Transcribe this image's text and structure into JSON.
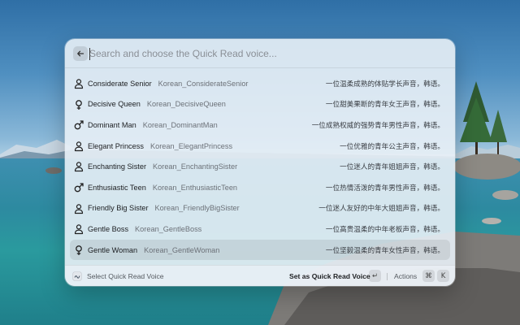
{
  "search": {
    "placeholder": "Search and choose the Quick Read voice..."
  },
  "voices": [
    {
      "title": "Considerate Senior",
      "id": "Korean_ConsiderateSenior",
      "desc": "一位温柔成熟的体贴学长声音，韩语。",
      "icon": "person-icon"
    },
    {
      "title": "Decisive Queen",
      "id": "Korean_DecisiveQueen",
      "desc": "一位甜美果断的青年女王声音，韩语。",
      "icon": "female-icon"
    },
    {
      "title": "Dominant Man",
      "id": "Korean_DominantMan",
      "desc": "一位成熟权威的强势青年男性声音，韩语。",
      "icon": "male-icon"
    },
    {
      "title": "Elegant Princess",
      "id": "Korean_ElegantPrincess",
      "desc": "一位优雅的青年公主声音，韩语。",
      "icon": "person-icon"
    },
    {
      "title": "Enchanting Sister",
      "id": "Korean_EnchantingSister",
      "desc": "一位迷人的青年姐姐声音，韩语。",
      "icon": "person-icon"
    },
    {
      "title": "Enthusiastic Teen",
      "id": "Korean_EnthusiasticTeen",
      "desc": "一位热情活泼的青年男性声音，韩语。",
      "icon": "male-icon"
    },
    {
      "title": "Friendly Big Sister",
      "id": "Korean_FriendlyBigSister",
      "desc": "一位迷人友好的中年大姐姐声音，韩语。",
      "icon": "person-icon"
    },
    {
      "title": "Gentle Boss",
      "id": "Korean_GentleBoss",
      "desc": "一位高贵温柔的中年老板声音，韩语。",
      "icon": "person-icon"
    },
    {
      "title": "Gentle Woman",
      "id": "Korean_GentleWoman",
      "desc": "一位坚毅温柔的青年女性声音，韩语。",
      "icon": "female-icon"
    }
  ],
  "selected_index": 8,
  "footer": {
    "hint": "Select Quick Read Voice",
    "primary_action": "Set as Quick Read Voice",
    "primary_key": "↵",
    "actions_label": "Actions",
    "actions_key_mod": "⌘",
    "actions_key": "K"
  },
  "colors": {
    "panel": "#e8eff6",
    "text": "#1d1f22",
    "subtle": "#6c7178",
    "selected": "#d9dde2"
  }
}
